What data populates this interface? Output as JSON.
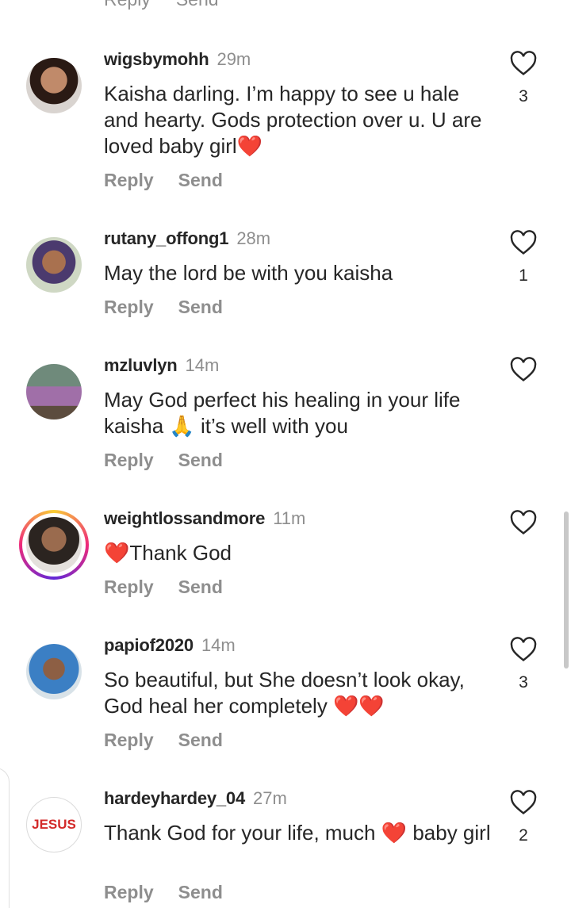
{
  "clipped_actions": {
    "reply": "Reply",
    "send": "Send"
  },
  "comments": [
    {
      "username": "wigsbymohh",
      "time": "29m",
      "text": "Kaisha darling. I’m happy to see u hale and hearty. Gods protection over u. U are loved baby girl",
      "emoji_end": "❤️",
      "reply": "Reply",
      "send": "Send",
      "likes": "3"
    },
    {
      "username": "rutany_offong1",
      "time": "28m",
      "text": "May the lord be with you kaisha",
      "reply": "Reply",
      "send": "Send",
      "likes": "1"
    },
    {
      "username": "mzluvlyn",
      "time": "14m",
      "text_a": "May God perfect his healing in your life kaisha ",
      "emoji_mid": "🙏",
      "text_b": " it’s well with you",
      "reply": "Reply",
      "send": "Send",
      "likes": ""
    },
    {
      "username": "weightlossandmore",
      "time": "11m",
      "emoji_start": "❤️",
      "text": "Thank God",
      "reply": "Reply",
      "send": "Send",
      "likes": ""
    },
    {
      "username": "papiof2020",
      "time": "14m",
      "text": "So beautiful, but She doesn’t look okay, God heal  her  completely ",
      "emoji_end": "❤️❤️",
      "reply": "Reply",
      "send": "Send",
      "likes": "3"
    },
    {
      "username": "hardeyhardey_04",
      "time": "27m",
      "avatar_text": "JESUS",
      "text_a": "Thank God for your life, much ",
      "emoji_mid": "❤️",
      "text_b": " baby girl",
      "reply": "Reply",
      "send": "Send",
      "likes": "2"
    }
  ],
  "colors": {
    "accent_heart": "#e0142a",
    "muted": "#8e8e8e",
    "text": "#262626"
  }
}
